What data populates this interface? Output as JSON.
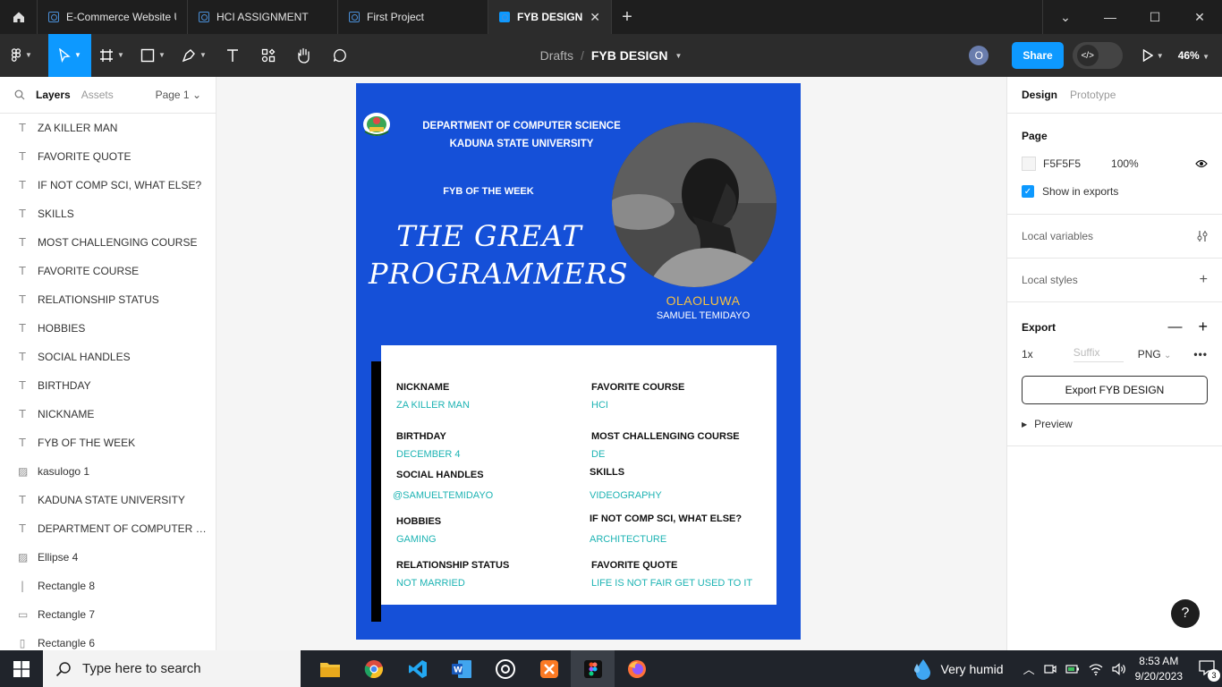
{
  "tabs": [
    {
      "label": "E-Commerce Website UI/UX (Commu"
    },
    {
      "label": "HCI ASSIGNMENT"
    },
    {
      "label": "First Project"
    },
    {
      "label": "FYB DESIGN"
    }
  ],
  "breadcrumb": {
    "drafts": "Drafts",
    "sep": "/",
    "file": "FYB DESIGN"
  },
  "toolbar": {
    "avatar": "O",
    "share": "Share",
    "zoom": "46%"
  },
  "left_panel": {
    "tab_layers": "Layers",
    "tab_assets": "Assets",
    "page_selector": "Page 1",
    "layers": [
      {
        "label": "ZA KILLER MAN",
        "icon": "T"
      },
      {
        "label": "FAVORITE QUOTE",
        "icon": "T"
      },
      {
        "label": "IF NOT COMP SCI, WHAT ELSE?",
        "icon": "T"
      },
      {
        "label": "SKILLS",
        "icon": "T"
      },
      {
        "label": "MOST CHALLENGING COURSE",
        "icon": "T"
      },
      {
        "label": "FAVORITE COURSE",
        "icon": "T"
      },
      {
        "label": "RELATIONSHIP STATUS",
        "icon": "T"
      },
      {
        "label": "HOBBIES",
        "icon": "T"
      },
      {
        "label": "SOCIAL HANDLES",
        "icon": "T"
      },
      {
        "label": "BIRTHDAY",
        "icon": "T"
      },
      {
        "label": "NICKNAME",
        "icon": "T"
      },
      {
        "label": "FYB OF THE WEEK",
        "icon": "T"
      },
      {
        "label": "kasulogo 1",
        "icon": "▨"
      },
      {
        "label": "KADUNA STATE UNIVERSITY",
        "icon": "T"
      },
      {
        "label": "DEPARTMENT OF COMPUTER SCI...",
        "icon": "T"
      },
      {
        "label": "Ellipse 4",
        "icon": "▨"
      },
      {
        "label": "Rectangle 8",
        "icon": "|"
      },
      {
        "label": "Rectangle 7",
        "icon": "▭"
      },
      {
        "label": "Rectangle 6",
        "icon": "▯"
      }
    ]
  },
  "poster": {
    "dept_line1": "DEPARTMENT OF COMPUTER SCIENCE",
    "dept_line2": "KADUNA STATE UNIVERSITY",
    "fyb_week": "FYB OF THE WEEK",
    "title_line1": "THE GREAT",
    "title_line2": "PROGRAMMERS",
    "name_first": "OLAOLUWA",
    "name_last": "SAMUEL TEMIDAYO",
    "fields": {
      "nickname": {
        "label": "NICKNAME",
        "value": "ZA KILLER MAN"
      },
      "favorite_course": {
        "label": "FAVORITE COURSE",
        "value": "HCI"
      },
      "birthday": {
        "label": "BIRTHDAY",
        "value": "DECEMBER 4"
      },
      "challenging": {
        "label": "MOST CHALLENGING COURSE",
        "value": "DE"
      },
      "social": {
        "label": "SOCIAL HANDLES",
        "value": "@SAMUELTEMIDAYO"
      },
      "skills": {
        "label": "SKILLS",
        "value": "VIDEOGRAPHY"
      },
      "hobbies": {
        "label": "HOBBIES",
        "value": "GAMING"
      },
      "else": {
        "label": "IF NOT COMP SCI, WHAT ELSE?",
        "value": "ARCHITECTURE"
      },
      "relationship": {
        "label": "RELATIONSHIP STATUS",
        "value": "NOT MARRIED"
      },
      "quote": {
        "label": "FAVORITE QUOTE",
        "value": "LIFE IS NOT FAIR GET USED TO IT"
      }
    },
    "colors": {
      "frame": "#1550d8",
      "name_accent": "#f5c244",
      "value_text": "#1db3b3"
    }
  },
  "help": "?",
  "right_panel": {
    "tab_design": "Design",
    "tab_prototype": "Prototype",
    "page_title": "Page",
    "page_color": "F5F5F5",
    "page_opacity": "100%",
    "show_in_exports": "Show in exports",
    "local_variables": "Local variables",
    "local_styles": "Local styles",
    "export_title": "Export",
    "export_scale": "1x",
    "export_suffix_placeholder": "Suffix",
    "export_format": "PNG",
    "export_button": "Export FYB DESIGN",
    "preview": "Preview"
  },
  "taskbar": {
    "search_placeholder": "Type here to search",
    "weather": "Very humid",
    "time": "8:53 AM",
    "date": "9/20/2023",
    "notifications": "3"
  }
}
